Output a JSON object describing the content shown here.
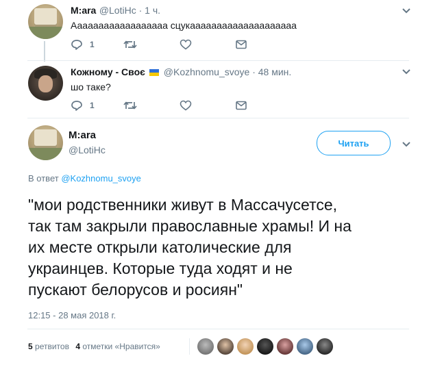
{
  "tweets": [
    {
      "name": "M:ara",
      "handle": "@LotiHc",
      "time": " · 1 ч.",
      "text": "Аааааааааааааааааа сцукаааааааааааааааааааа",
      "replies": "1"
    },
    {
      "name": "Кожному - Своє",
      "handle": "@Kozhnomu_svoye",
      "time": " · 48 мин.",
      "text": "шо таке?",
      "replies": "1"
    }
  ],
  "main_tweet": {
    "name": "M:ara",
    "handle": "@LotiHc",
    "follow_label": "Читать",
    "reply_prefix": "В ответ",
    "reply_to": "@Kozhnomu_svoye",
    "text_lines": [
      "\"мои родственники живут в Массачусетсе,",
      "так там закрыли православные храмы! И на",
      "их месте открыли католические для",
      "украинцев. Которые туда ходят и не",
      "пускают белорусов и росиян\""
    ],
    "timestamp": "12:15 - 28 мая 2018 г.",
    "retweets_count": "5",
    "retweets_label": "ретвитов",
    "likes_count": "4",
    "likes_label": "отметки «Нравится»"
  },
  "colors": {
    "accent": "#1da1f2",
    "secondary_text": "#657786",
    "primary_text": "#14171a"
  },
  "icons": [
    "reply-icon",
    "retweet-icon",
    "like-icon",
    "dm-icon",
    "chevron-down-icon"
  ]
}
